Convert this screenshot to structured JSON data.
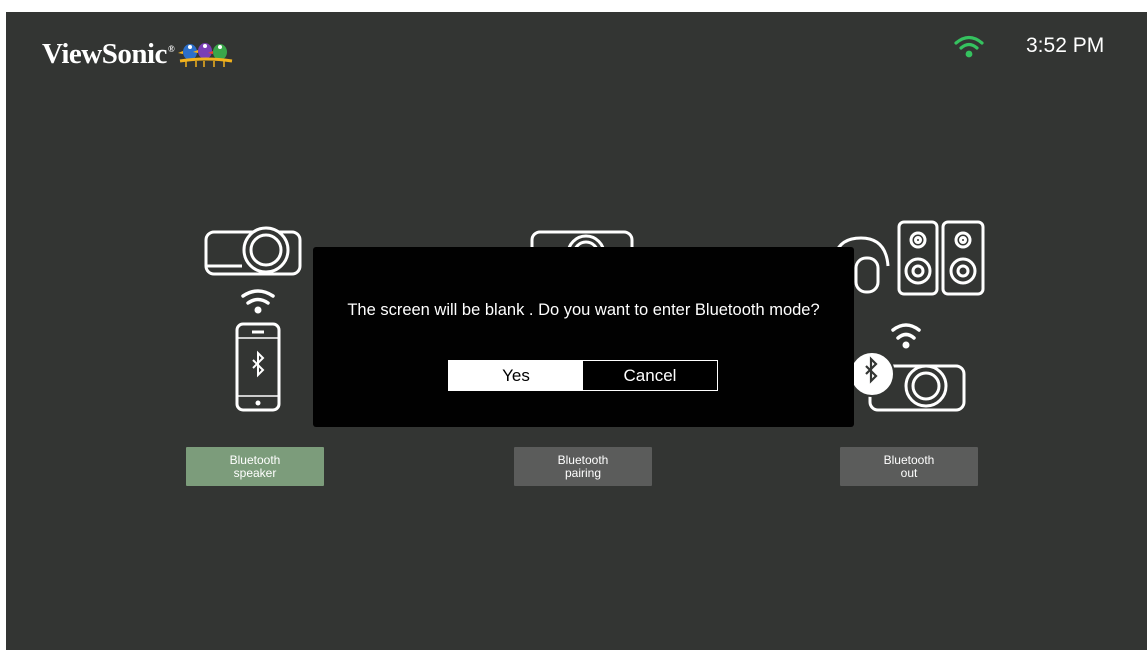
{
  "header": {
    "brand": "ViewSonic",
    "brand_mark": "®",
    "time": "3:52 PM",
    "wifi_color": "#35c25f"
  },
  "options": [
    {
      "label_line1": "Bluetooth",
      "label_line2": "speaker",
      "selected": true,
      "icon": "phone-to-projector-icon"
    },
    {
      "label_line1": "Bluetooth",
      "label_line2": "pairing",
      "selected": false,
      "icon": "projector-pairing-icon"
    },
    {
      "label_line1": "Bluetooth",
      "label_line2": "out",
      "selected": false,
      "icon": "projector-to-speakers-icon"
    }
  ],
  "dialog": {
    "message": "The screen will be blank . Do you want to enter Bluetooth mode?",
    "yes_label": "Yes",
    "cancel_label": "Cancel"
  },
  "colors": {
    "background": "#333533",
    "selected_option": "#7c9c7b",
    "option": "#5b5c5b",
    "dialog": "#010101"
  }
}
